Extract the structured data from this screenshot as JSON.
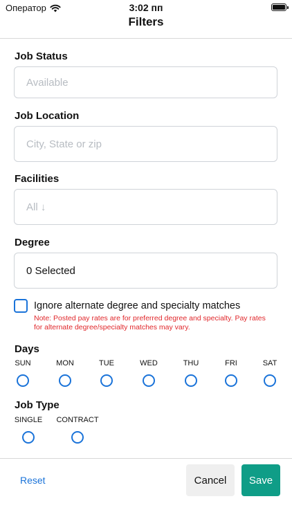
{
  "status_bar": {
    "carrier": "Оператор",
    "time": "3:02 пп"
  },
  "header": {
    "title": "Filters"
  },
  "job_status": {
    "label": "Job Status",
    "placeholder": "Available"
  },
  "job_location": {
    "label": "Job Location",
    "placeholder": "City, State or zip"
  },
  "facilities": {
    "label": "Facilities",
    "placeholder": "All ↓"
  },
  "degree": {
    "label": "Degree",
    "value": "0 Selected"
  },
  "ignore_alternate": {
    "label": "Ignore alternate degree and specialty matches",
    "checked": false,
    "note": "Note: Posted pay rates are for preferred degree and specialty. Pay rates for alternate degree/specialty matches may vary."
  },
  "days": {
    "label": "Days",
    "items": [
      {
        "label": "SUN",
        "selected": false
      },
      {
        "label": "MON",
        "selected": false
      },
      {
        "label": "TUE",
        "selected": false
      },
      {
        "label": "WED",
        "selected": false
      },
      {
        "label": "THU",
        "selected": false
      },
      {
        "label": "FRI",
        "selected": false
      },
      {
        "label": "SAT",
        "selected": false
      }
    ]
  },
  "job_type": {
    "label": "Job Type",
    "items": [
      {
        "label": "SINGLE",
        "selected": false
      },
      {
        "label": "CONTRACT",
        "selected": false
      }
    ]
  },
  "footer": {
    "reset_label": "Reset",
    "cancel_label": "Cancel",
    "save_label": "Save"
  },
  "colors": {
    "accent": "#1a73d9",
    "save": "#0f9d87",
    "note": "#e0262a"
  }
}
